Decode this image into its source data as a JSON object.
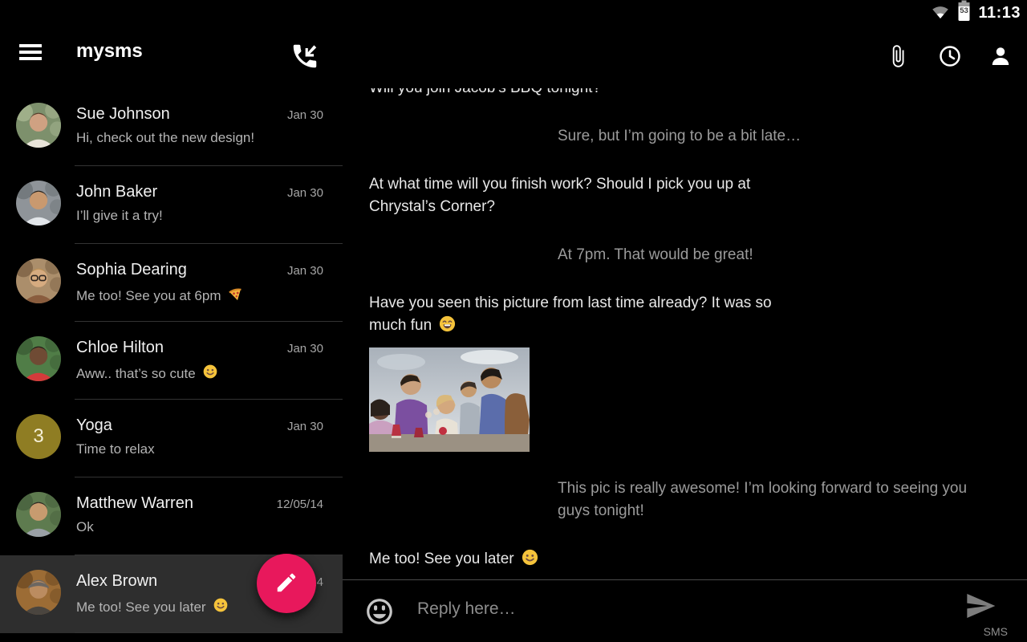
{
  "status_bar": {
    "time": "11:13",
    "battery_percent": "53",
    "wifi_icon": "wifi-signal",
    "battery_icon": "battery-level"
  },
  "toolbar": {
    "title": "mysms",
    "menu_icon": "hamburger-menu",
    "incoming_call_icon": "incoming-call",
    "attach_icon": "paperclip",
    "schedule_icon": "clock",
    "contact_icon": "person"
  },
  "conversation_list": {
    "items": [
      {
        "name": "Sue Johnson",
        "date": "Jan 30",
        "preview": "Hi, check out the new design!",
        "preview_emoji": "",
        "selected": false,
        "avatar": {
          "kind": "photo",
          "bg": "#7d906c",
          "bg2": "#a8b691",
          "skin": "#cfa182",
          "hair": "#5a3d2b",
          "shirt": "#e9e4da",
          "extra": "none"
        }
      },
      {
        "name": "John Baker",
        "date": "Jan 30",
        "preview": "I’ll give it a try!",
        "preview_emoji": "",
        "selected": false,
        "avatar": {
          "kind": "photo",
          "bg": "#8f9499",
          "bg2": "#6d7377",
          "skin": "#c9996f",
          "hair": "#26211c",
          "shirt": "#e2e6ea",
          "extra": "none"
        }
      },
      {
        "name": "Sophia Dearing",
        "date": "Jan 30",
        "preview": "Me too! See you at 6pm",
        "preview_emoji": "pizza",
        "selected": false,
        "avatar": {
          "kind": "photo",
          "bg": "#ab8e6b",
          "bg2": "#7d6245",
          "skin": "#d6ab80",
          "hair": "#bb9158",
          "shirt": "#8a5d3e",
          "extra": "glasses"
        }
      },
      {
        "name": "Chloe Hilton",
        "date": "Jan 30",
        "preview": "Aww.. that’s so cute",
        "preview_emoji": "smile",
        "selected": false,
        "avatar": {
          "kind": "photo",
          "bg": "#507d47",
          "bg2": "#3b5d35",
          "skin": "#6f4b34",
          "hair": "#221b16",
          "shirt": "#d43b3b",
          "extra": "none"
        }
      },
      {
        "name": "Yoga",
        "date": "Jan 30",
        "preview": "Time to relax",
        "preview_emoji": "",
        "selected": false,
        "avatar": {
          "kind": "badge",
          "badge_text": "3",
          "badge_bg": "#8f7d23",
          "badge_fg": "#f5f0d8"
        }
      },
      {
        "name": "Matthew Warren",
        "date": "12/05/14",
        "preview": "Ok",
        "preview_emoji": "",
        "selected": false,
        "avatar": {
          "kind": "photo",
          "bg": "#5e7b4f",
          "bg2": "#47613d",
          "skin": "#c79b6f",
          "hair": "#2c2520",
          "shirt": "#9aa0a6",
          "extra": "none"
        }
      },
      {
        "name": "Alex Brown",
        "date": "12/05/14",
        "preview": "Me too! See you later",
        "preview_emoji": "smile",
        "selected": true,
        "avatar": {
          "kind": "photo",
          "bg": "#9c6c35",
          "bg2": "#6f4b23",
          "skin": "#bb8c60",
          "hair": "#6c6762",
          "shirt": "#4a453f",
          "extra": "cap"
        }
      }
    ]
  },
  "chat": {
    "messages": [
      {
        "direction": "incoming",
        "text": "Will you join Jacob’s BBQ tonight?",
        "emoji": "",
        "image": "",
        "clipped": true
      },
      {
        "direction": "outgoing",
        "text": "Sure, but I’m going to be a bit late…",
        "emoji": "",
        "image": "",
        "clipped": false
      },
      {
        "direction": "incoming",
        "text": "At what time will you finish work? Should I pick you up at Chrystal’s Corner?",
        "emoji": "",
        "image": "",
        "clipped": false
      },
      {
        "direction": "outgoing",
        "text": "At 7pm. That would be great!",
        "emoji": "",
        "image": "",
        "clipped": false
      },
      {
        "direction": "incoming",
        "text": "Have you seen this picture from last time already? It was so much fun",
        "emoji": "grin",
        "image": "party-photo",
        "clipped": false
      },
      {
        "direction": "outgoing",
        "text": "This pic is really awesome! I’m looking forward to seeing you guys tonight!",
        "emoji": "",
        "image": "",
        "clipped": false
      },
      {
        "direction": "incoming",
        "text": "Me too! See you later",
        "emoji": "smile",
        "image": "",
        "clipped": false
      }
    ],
    "reply_bar": {
      "placeholder": "Reply here…",
      "send_label": "SMS",
      "emoji_icon": "smiley-face",
      "send_icon": "send-arrow"
    }
  },
  "fab": {
    "icon": "pencil-compose"
  },
  "colors": {
    "accent": "#e8185c",
    "selected_row": "#2e2e2e",
    "incoming_text": "#e8e8e8",
    "outgoing_text": "#9b9b9b",
    "badge_bg": "#8f7d23"
  }
}
